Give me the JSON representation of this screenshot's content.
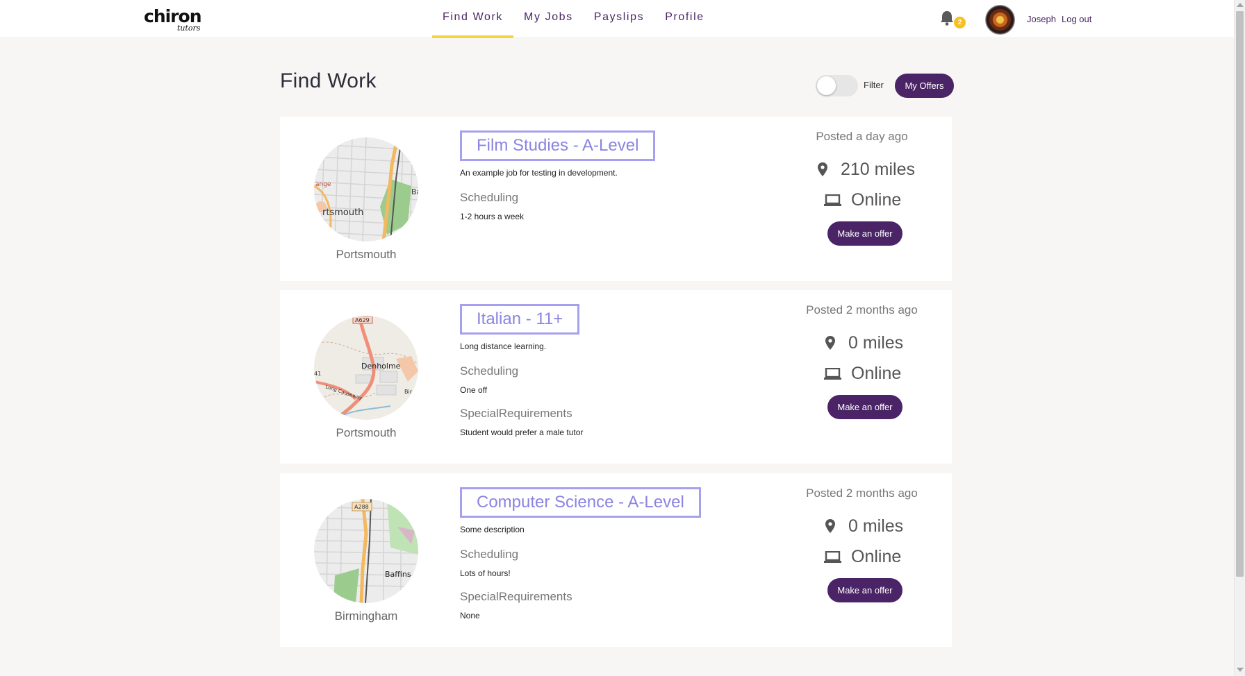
{
  "brand": {
    "name": "chiron",
    "script": "tutors"
  },
  "nav": {
    "items": [
      {
        "label": "Find Work",
        "active": true
      },
      {
        "label": "My Jobs",
        "active": false
      },
      {
        "label": "Payslips",
        "active": false
      },
      {
        "label": "Profile",
        "active": false
      }
    ],
    "notifications": {
      "icon": "bell-icon",
      "count": "2"
    },
    "user": {
      "name": "Joseph",
      "logout_label": "Log out"
    }
  },
  "page": {
    "title": "Find Work",
    "filter_label": "Filter",
    "filter_on": false,
    "my_offers_label": "My Offers"
  },
  "jobs": [
    {
      "title": "Film Studies - A-Level",
      "description": "An example job for testing in development.",
      "city": "Portsmouth",
      "scheduling_label": "Scheduling",
      "scheduling": "1-2 hours a week",
      "posted": "Posted a day ago",
      "distance": "210 miles",
      "mode": "Online",
      "button": "Make an offer",
      "map_labels": [
        "ange",
        "rtsmouth",
        "Ba"
      ]
    },
    {
      "title": "Italian - 11+",
      "description": "Long distance learning.",
      "city": "Portsmouth",
      "scheduling_label": "Scheduling",
      "scheduling": "One off",
      "special_label": "SpecialRequirements",
      "special": "Student would prefer a male tutor",
      "posted": "Posted 2 months ago",
      "distance": "0 miles",
      "mode": "Online",
      "button": "Make an offer",
      "map_labels": [
        "A629",
        "Denholme",
        "Long Causeway",
        "41",
        "Bir"
      ]
    },
    {
      "title": "Computer Science - A-Level",
      "description": "Some description",
      "city": "Birmingham",
      "scheduling_label": "Scheduling",
      "scheduling": "Lots of hours!",
      "special_label": "SpecialRequirements",
      "special": "None",
      "posted": "Posted 2 months ago",
      "distance": "0 miles",
      "mode": "Online",
      "button": "Make an offer",
      "map_labels": [
        "A288",
        "Baffins"
      ]
    }
  ],
  "colors": {
    "brand_purple": "#4a2466",
    "nav_underline": "#f5d33a",
    "title_border": "#a6a0ee",
    "title_text": "#8a84e2",
    "badge": "#f6c020"
  }
}
